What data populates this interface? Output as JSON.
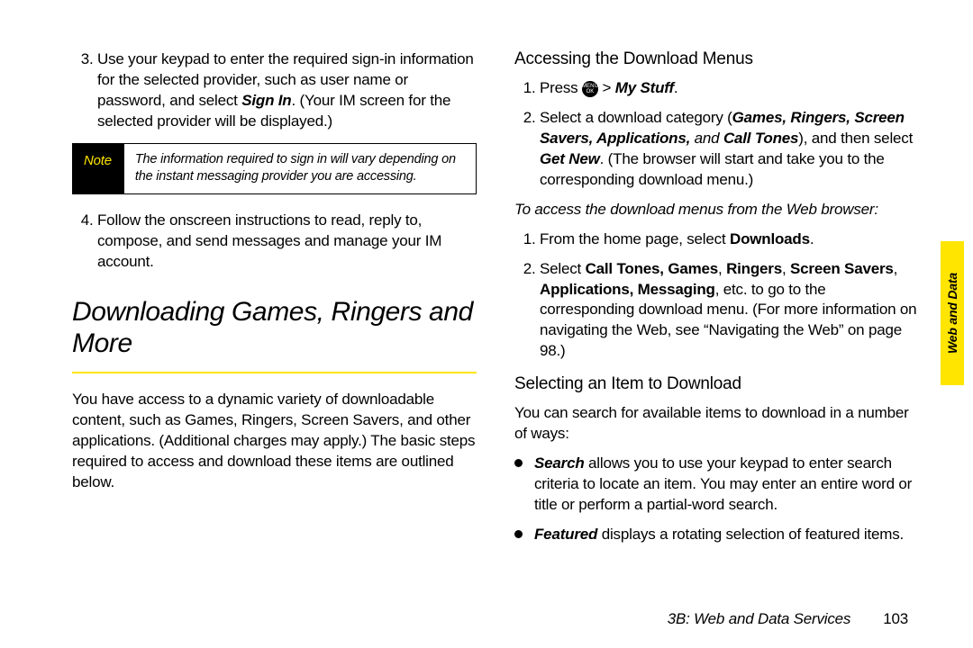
{
  "left": {
    "step3": {
      "t1": "Use your keypad to enter the required sign-in information for the selected provider, such as user name or password, and select ",
      "signin": "Sign In",
      "t2": ". (Your IM screen for the selected provider will be displayed.)"
    },
    "note": {
      "label": "Note",
      "body": "The information required to sign in will vary depending on the instant messaging provider you are accessing."
    },
    "step4": "Follow the onscreen instructions to read, reply to, compose, and send messages and manage your IM account.",
    "heading": "Downloading Games, Ringers and More",
    "intro": "You have access to a dynamic variety of downloadable content, such as Games, Ringers, Screen Savers, and other applications. (Additional charges may apply.) The basic steps required to access and download these items are outlined below."
  },
  "right": {
    "h_access": "Accessing the Download Menus",
    "access_list": {
      "s1_pre": "Press ",
      "s1_gt": " > ",
      "s1_mystuff": "My Stuff",
      "s1_post": ".",
      "s2_pre": "Select a download category (",
      "s2_cats": "Games, Ringers, Screen Savers, Applications,",
      "s2_and": " and ",
      "s2_calltones": "Call Tones",
      "s2_mid1": "), and then select ",
      "s2_getnew": "Get New",
      "s2_mid2": ". (The browser will start and take you to the corresponding download menu.)"
    },
    "web_intro": "To access the download menus from the Web browser:",
    "web_list": {
      "s1_pre": "From the home page, select ",
      "s1_dl": "Downloads",
      "s1_post": ".",
      "s2_pre": "Select ",
      "s2_bold": "Call Tones, Games",
      "s2_t1": ", ",
      "s2_b2": "Ringers",
      "s2_t2": ", ",
      "s2_b3": "Screen Savers",
      "s2_t3": ", ",
      "s2_b4": "Applications, Messaging",
      "s2_rest": ", etc. to go to the corresponding download menu. (For more information on navigating the Web, see “Navigating the Web” on page 98.)"
    },
    "h_select": "Selecting an Item to Download",
    "select_intro": "You can search for available items to download in a number of ways:",
    "bullets": {
      "b1_lead": "Search",
      "b1_rest": " allows you to use your keypad to enter search criteria to locate an item. You may enter an entire word or title or perform a partial-word search.",
      "b2_lead": "Featured",
      "b2_rest": " displays a rotating selection of featured items."
    }
  },
  "sidetab": "Web and Data",
  "footer": {
    "section": "3B: Web and Data Services",
    "page": "103"
  },
  "icon": {
    "menu": "MENU",
    "ok": "OK"
  }
}
